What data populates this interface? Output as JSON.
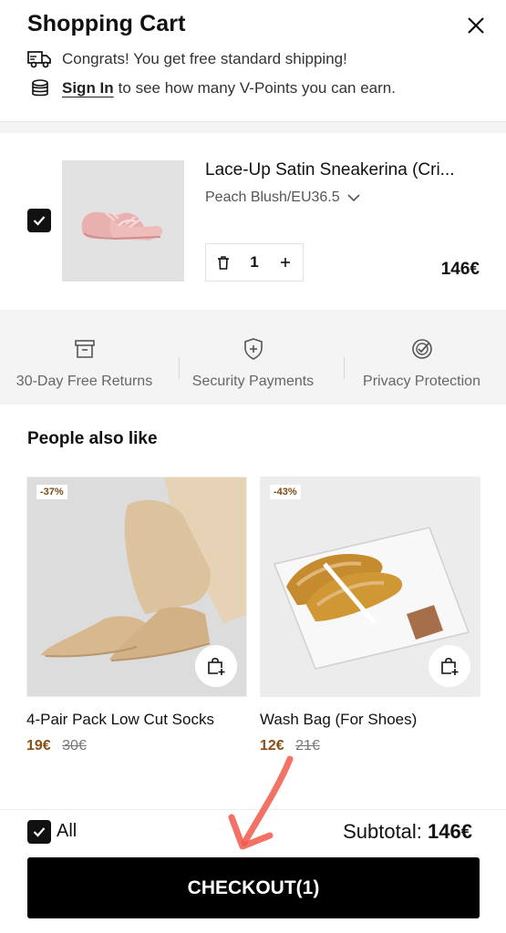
{
  "header": {
    "title": "Shopping Cart",
    "shipping_text": "Congrats! You get free standard shipping!",
    "signin_label": "Sign In",
    "signin_suffix": "to see how many V-Points you can earn."
  },
  "cart": {
    "item": {
      "name": "Lace-Up Satin Sneakerina (Cri...",
      "variant": "Peach Blush/EU36.5",
      "quantity": "1",
      "price": "146€",
      "checked": true
    }
  },
  "guarantees": [
    {
      "label": "30-Day Free Returns",
      "icon": "return-box-icon"
    },
    {
      "label": "Security Payments",
      "icon": "shield-plus-icon"
    },
    {
      "label": "Privacy Protection",
      "icon": "check-badge-icon"
    }
  ],
  "recommendations": {
    "title": "People also like",
    "products": [
      {
        "name": "4-Pair Pack Low Cut Socks",
        "price": "19€",
        "original_price": "30€",
        "discount": "-37%"
      },
      {
        "name": "Wash Bag (For Shoes)",
        "price": "12€",
        "original_price": "21€",
        "discount": "-43%"
      }
    ]
  },
  "footer": {
    "all_label": "All",
    "subtotal_label": "Subtotal:",
    "subtotal_value": "146€",
    "checkout_label": "CHECKOUT(1)"
  },
  "colors": {
    "accent": "#000000",
    "sale_price": "#8b4e14",
    "annotation_arrow": "#f05a4a"
  }
}
